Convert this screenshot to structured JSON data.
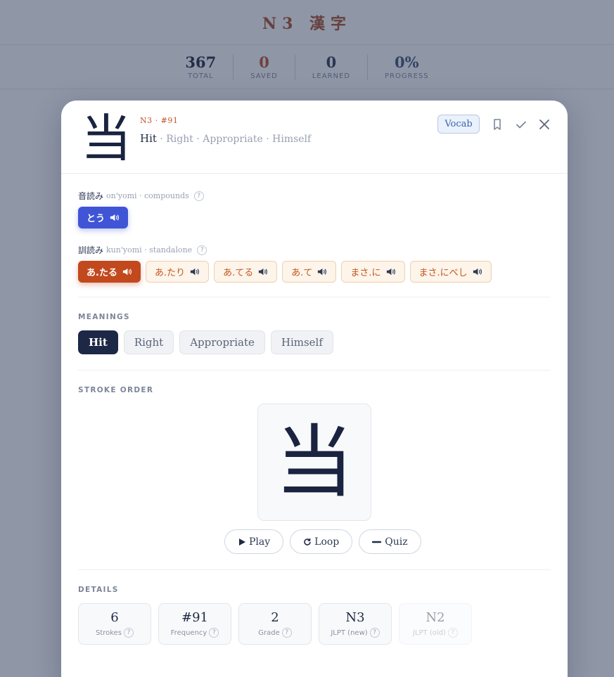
{
  "background": {
    "title": "N3 漢字",
    "stats": [
      {
        "value": "367",
        "label": "TOTAL"
      },
      {
        "value": "0",
        "label": "SAVED"
      },
      {
        "value": "0",
        "label": "LEARNED"
      },
      {
        "value": "0%",
        "label": "PROGRESS"
      }
    ]
  },
  "modal": {
    "kanji": "当",
    "meta": "N3 · #91",
    "primary_meaning": "Hit",
    "other_meanings": " · Right · Appropriate · Himself",
    "vocab_label": "Vocab",
    "icons": [
      "bookmark-icon",
      "check-icon",
      "close-icon"
    ],
    "onyomi": {
      "label_jp": "音読み",
      "label_en": "on'yomi · compounds",
      "help": "?",
      "readings": [
        "とう"
      ]
    },
    "kunyomi": {
      "label_jp": "訓読み",
      "label_en": "kun'yomi · standalone",
      "help": "?",
      "readings": [
        "あ.たる",
        "あ.たり",
        "あ.てる",
        "あ.て",
        "まさ.に",
        "まさ.にべし"
      ]
    },
    "meanings_title": "MEANINGS",
    "meanings": [
      "Hit",
      "Right",
      "Appropriate",
      "Himself"
    ],
    "stroke_title": "STROKE ORDER",
    "stroke_buttons": [
      {
        "icon": "play-icon",
        "label": "Play"
      },
      {
        "icon": "loop-icon",
        "label": "Loop"
      },
      {
        "icon": "quiz-icon",
        "label": "Quiz"
      }
    ],
    "details_title": "DETAILS",
    "details": [
      {
        "value": "6",
        "label": "Strokes"
      },
      {
        "value": "#91",
        "label": "Frequency"
      },
      {
        "value": "2",
        "label": "Grade"
      },
      {
        "value": "N3",
        "label": "JLPT (new)"
      },
      {
        "value": "N2",
        "label": "JLPT (old)"
      }
    ]
  },
  "colors": {
    "onyomi_active": "#3f55d6",
    "kunyomi_active": "#c2481d",
    "meaning_active": "#1c2846",
    "accent_meta": "#c0562c"
  }
}
